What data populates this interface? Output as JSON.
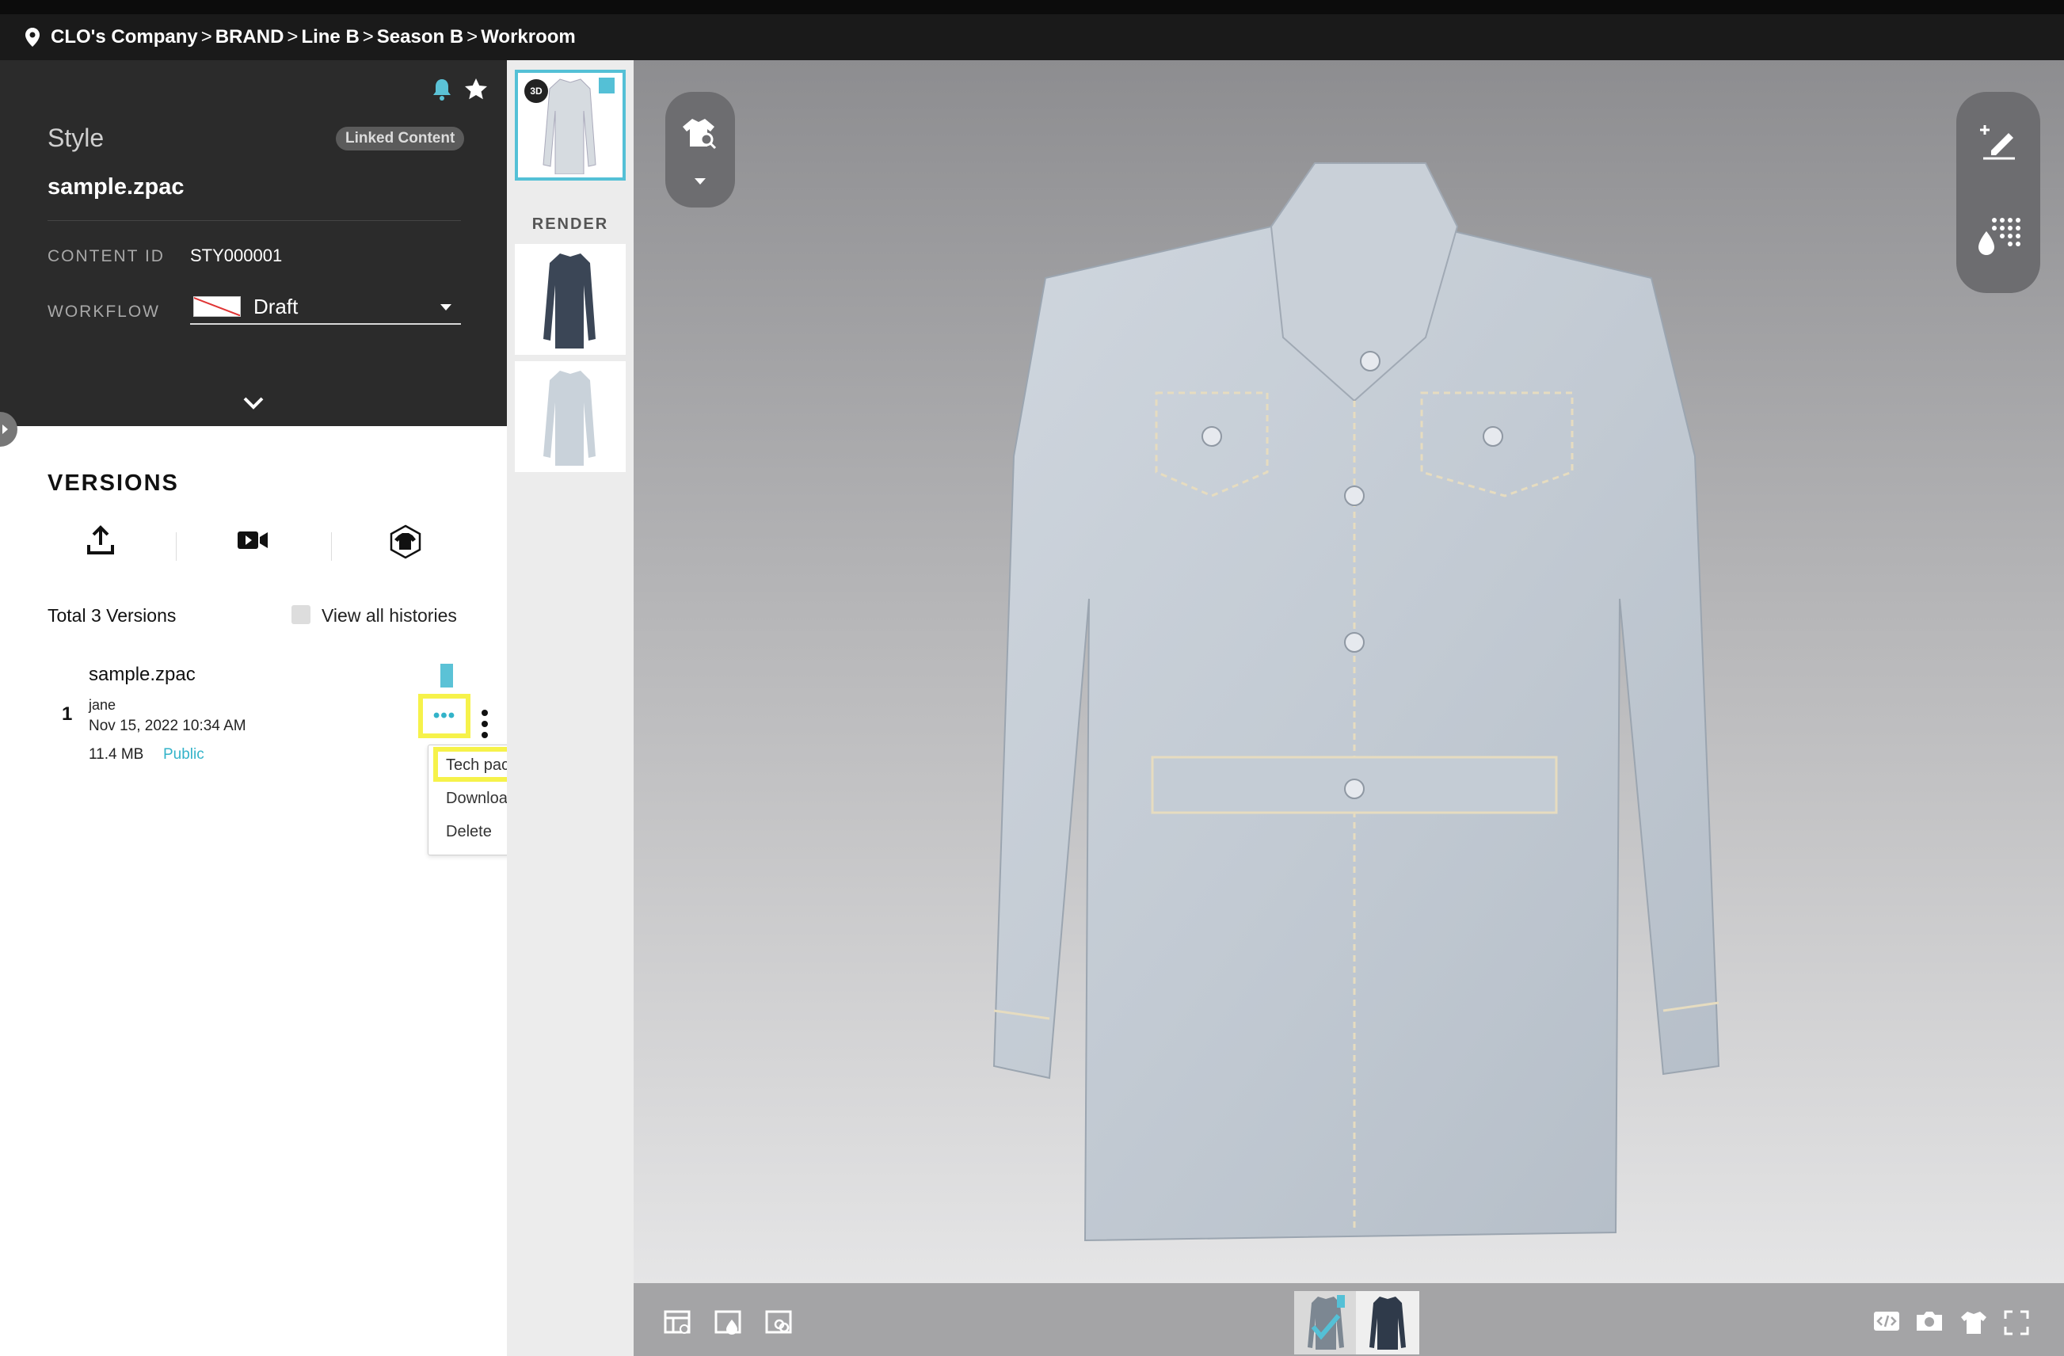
{
  "breadcrumb": {
    "items": [
      "CLO's Company",
      "BRAND",
      "Line B",
      "Season B",
      "Workroom"
    ],
    "separator": ">"
  },
  "style_panel": {
    "title": "Style",
    "linked_badge": "Linked Content",
    "file_name": "sample.zpac",
    "content_id_label": "CONTENT ID",
    "content_id_value": "STY000001",
    "workflow_label": "WORKFLOW",
    "workflow_value": "Draft"
  },
  "versions": {
    "title": "VERSIONS",
    "toolbar": [
      "upload-icon",
      "video-icon",
      "garment-3d-icon"
    ],
    "total_label": "Total 3 Versions",
    "view_all_label": "View all histories",
    "items": [
      {
        "index": "1",
        "name": "sample.zpac",
        "user": "jane",
        "date": "Nov 15, 2022 10:34 AM",
        "size": "11.4 MB",
        "visibility": "Public"
      }
    ],
    "more_label": "•••",
    "menu": [
      "Tech pack",
      "Download...",
      "Delete"
    ]
  },
  "thumbnails": {
    "badge": "3D",
    "render_label": "RENDER"
  },
  "colors": {
    "accent": "#54c0d6",
    "highlight": "#f6f24a",
    "panel": "#2b2b2b",
    "topbar": "#1a1a1a"
  }
}
